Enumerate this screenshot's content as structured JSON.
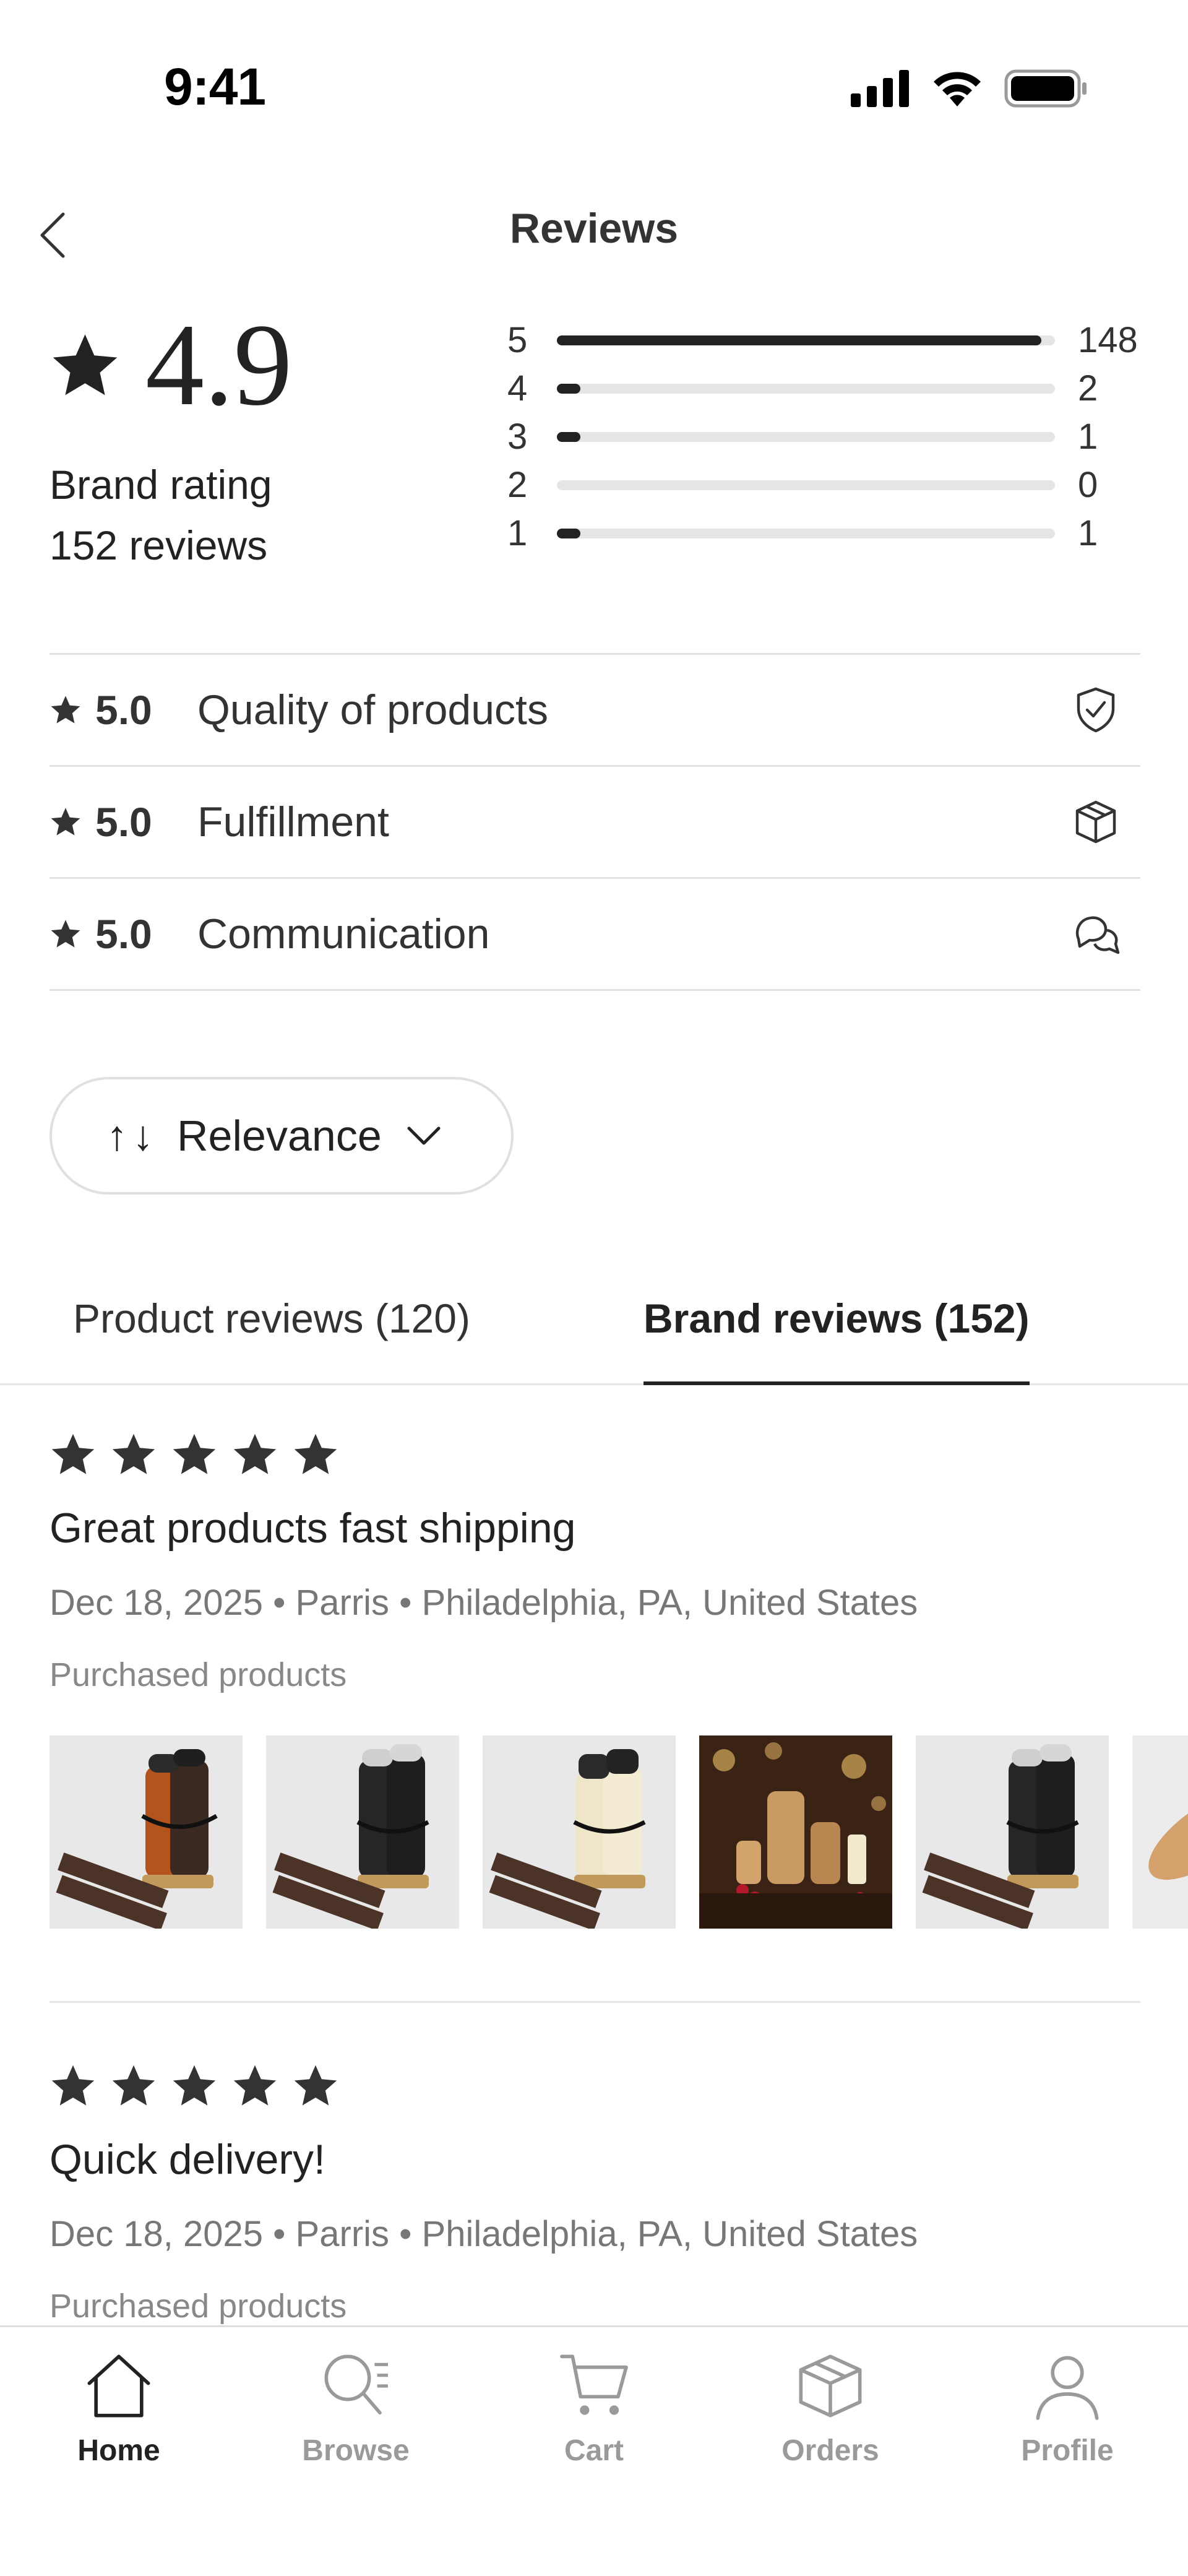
{
  "status_bar": {
    "time": "9:41"
  },
  "header": {
    "title": "Reviews"
  },
  "summary": {
    "rating": "4.9",
    "label": "Brand rating",
    "review_count": "152 reviews"
  },
  "distribution": [
    {
      "stars": "5",
      "count": "148",
      "fraction": 0.973
    },
    {
      "stars": "4",
      "count": "2",
      "fraction": 0.013
    },
    {
      "stars": "3",
      "count": "1",
      "fraction": 0.007
    },
    {
      "stars": "2",
      "count": "0",
      "fraction": 0
    },
    {
      "stars": "1",
      "count": "1",
      "fraction": 0.007
    }
  ],
  "categories": [
    {
      "score": "5.0",
      "name": "Quality of products",
      "icon": "shield-check-icon"
    },
    {
      "score": "5.0",
      "name": "Fulfillment",
      "icon": "box-icon"
    },
    {
      "score": "5.0",
      "name": "Communication",
      "icon": "chat-bubbles-icon"
    }
  ],
  "sort": {
    "arrows": "↑↓",
    "label": "Relevance"
  },
  "tabs": {
    "product": "Product reviews (120)",
    "brand": "Brand reviews (152)",
    "active": "brand"
  },
  "reviews": [
    {
      "stars": 5,
      "title": "Great products fast shipping",
      "meta": "Dec 18, 2025 • Parris • Philadelphia, PA, United States",
      "purchased_label": "Purchased products"
    },
    {
      "stars": 5,
      "title": "Quick delivery!",
      "meta": "Dec 18, 2025 • Parris • Philadelphia, PA, United States",
      "purchased_label": "Purchased products"
    }
  ],
  "nav": {
    "home": "Home",
    "browse": "Browse",
    "cart": "Cart",
    "orders": "Orders",
    "profile": "Profile",
    "active": "home"
  },
  "colors": {
    "text": "#222222",
    "muted": "#777777",
    "divider": "#e2e2e2",
    "bar_track": "#e5e5e5"
  }
}
